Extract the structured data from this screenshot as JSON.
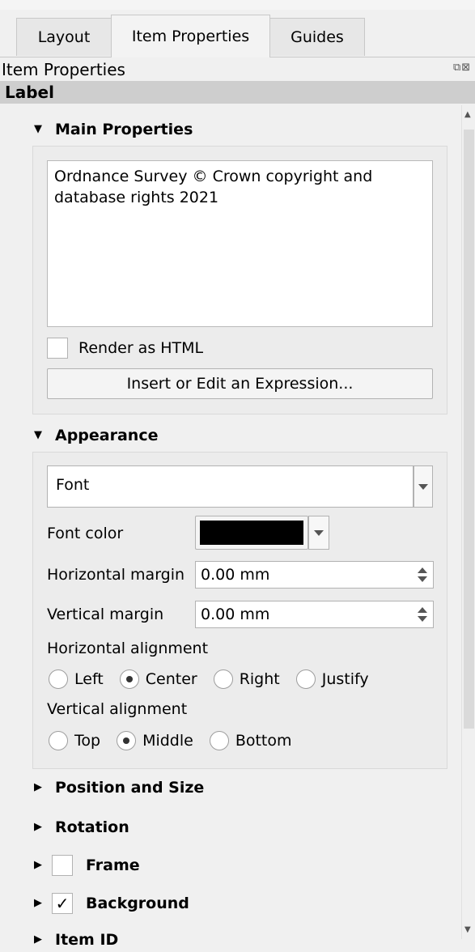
{
  "tabs": [
    {
      "label": "Layout"
    },
    {
      "label": "Item Properties"
    },
    {
      "label": "Guides"
    }
  ],
  "panel_title": "Item Properties",
  "item_type": "Label",
  "main_properties": {
    "title": "Main Properties",
    "label_text": "Ordnance Survey © Crown copyright and\ndatabase rights 2021",
    "render_html_label": "Render as HTML",
    "render_html_checked": false,
    "expression_button": "Insert or Edit an Expression..."
  },
  "appearance": {
    "title": "Appearance",
    "font_button": "Font",
    "font_color_label": "Font color",
    "font_color": "#000000",
    "h_margin_label": "Horizontal margin",
    "h_margin_value": "0.00 mm",
    "v_margin_label": "Vertical margin",
    "v_margin_value": "0.00 mm",
    "h_align_label": "Horizontal alignment",
    "h_align_options": [
      "Left",
      "Center",
      "Right",
      "Justify"
    ],
    "h_align_selected": "Center",
    "v_align_label": "Vertical alignment",
    "v_align_options": [
      "Top",
      "Middle",
      "Bottom"
    ],
    "v_align_selected": "Middle"
  },
  "collapsed_sections": {
    "position_size": "Position and Size",
    "rotation": "Rotation",
    "frame": "Frame",
    "frame_checked": false,
    "background": "Background",
    "background_checked": true,
    "item_id": "Item ID"
  }
}
